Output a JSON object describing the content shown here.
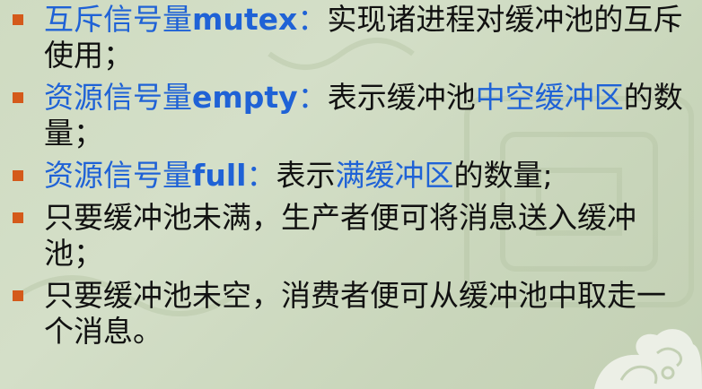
{
  "colors": {
    "background": "#cfdbc1",
    "bullet": "#d45a1b",
    "text": "#111111",
    "highlight": "#1f62d6"
  },
  "items": [
    {
      "term": "互斥信号量",
      "term_latin": "mutex",
      "colon": "：",
      "desc": "实现诸进程对缓冲池的互斥使用；"
    },
    {
      "term": "资源信号量",
      "term_latin": "empty",
      "colon": "：",
      "desc_before": "表示缓冲池",
      "desc_highlight": "中空缓冲区",
      "desc_after": "的数量；"
    },
    {
      "term": "资源信号量",
      "term_latin": "full",
      "colon": "：",
      "desc_before": "表示",
      "desc_highlight": "满缓冲区",
      "desc_after": "的数量;"
    },
    {
      "text": "只要缓冲池未满，生产者便可将消息送入缓冲池；"
    },
    {
      "text": "只要缓冲池未空，消费者便可从缓冲池中取走一个消息。"
    }
  ]
}
